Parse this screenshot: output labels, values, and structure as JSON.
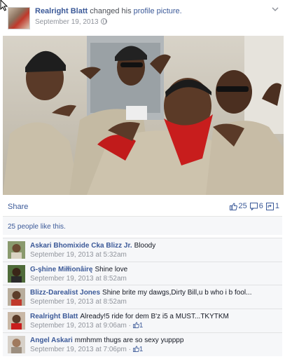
{
  "post": {
    "author": "Realright Blatt",
    "action_text": "changed his",
    "action_link": "profile picture.",
    "date": "September 19, 2013"
  },
  "share_bar": {
    "share_label": "Share",
    "likes": "25",
    "comments": "6",
    "shares": "1"
  },
  "likes_summary": "25 people like this.",
  "comments": [
    {
      "author": "Askari Bhomixide Cka Blizz Jr.",
      "text": "Bloody",
      "timestamp": "September 19, 2013 at 5:32am",
      "like_count": ""
    },
    {
      "author": "G-şhine Miłłionâirę",
      "text": "Shine love",
      "timestamp": "September 19, 2013 at 8:52am",
      "like_count": ""
    },
    {
      "author": "Blizz-Darealist Jones",
      "text": "Shine brite my dawgs,Dirty Bill,u b who i b fool...",
      "timestamp": "September 19, 2013 at 8:52am",
      "like_count": ""
    },
    {
      "author": "Realright Blatt",
      "text": "Already!5 ride for dem B'z i5 a MUST...TKYTKM",
      "timestamp": "September 19, 2013 at 9:06am",
      "like_count": "1"
    },
    {
      "author": "Angel Askari",
      "text": "mmhmm thugs are so sexy yupppp",
      "timestamp": "September 19, 2013 at 7:06pm",
      "like_count": "1"
    }
  ],
  "colors": {
    "link": "#3b5998",
    "meta": "#90949c",
    "comment_bg": "#f6f7f9"
  }
}
